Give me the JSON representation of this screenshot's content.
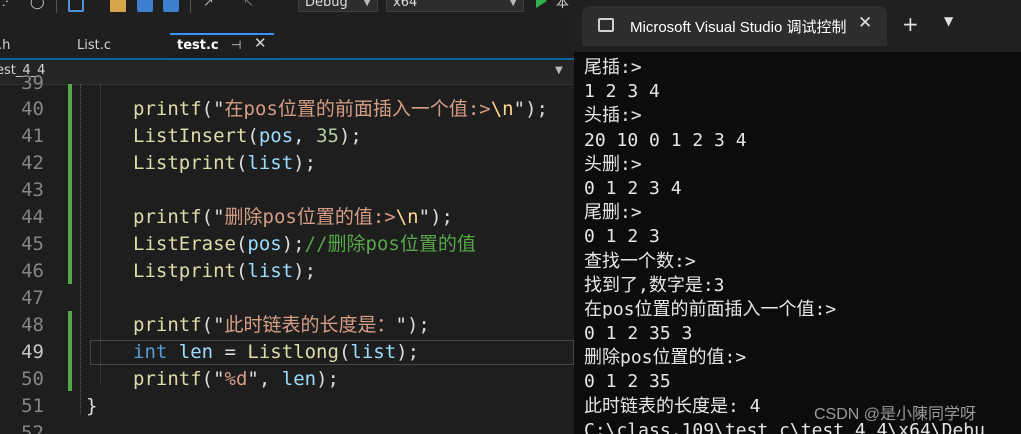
{
  "toolbar": {
    "config": "Debug",
    "platform": "x64",
    "run_label": "本"
  },
  "tabs": [
    {
      "label": ".h"
    },
    {
      "label": "List.c"
    },
    {
      "label": "test.c"
    }
  ],
  "nav": {
    "scope": "est_4_4"
  },
  "code": {
    "line_numbers": [
      "39",
      "40",
      "41",
      "42",
      "43",
      "44",
      "45",
      "46",
      "47",
      "48",
      "49",
      "50",
      "51",
      "52"
    ],
    "l40": {
      "fn": "printf",
      "lp": "(\"",
      "str": "在pos位置的前面插入一个值:>",
      "esc": "\\n",
      "rp": "\");"
    },
    "l41": {
      "fn": "ListInsert",
      "lp": "(",
      "var": "pos",
      "mid": ", ",
      "num": "35",
      "rp": ");"
    },
    "l42": {
      "fn": "Listprint",
      "lp": "(",
      "var": "list",
      "rp": ");"
    },
    "l44": {
      "fn": "printf",
      "lp": "(\"",
      "str": "删除pos位置的值:>",
      "esc": "\\n",
      "rp": "\");"
    },
    "l45": {
      "fn": "ListErase",
      "lp": "(",
      "var": "pos",
      "rp": ");",
      "cm": "//删除pos位置的值"
    },
    "l46": {
      "fn": "Listprint",
      "lp": "(",
      "var": "list",
      "rp": ");"
    },
    "l48": {
      "fn": "printf",
      "lp": "(\"",
      "str": "此时链表的长度是：",
      "rp": "\");"
    },
    "l49": {
      "kw": "int",
      "var1": " len",
      "eq": " = ",
      "fn": "Listlong",
      "lp": "(",
      "var2": "list",
      "rp": ");"
    },
    "l50": {
      "fn": "printf",
      "lp": "(\"",
      "str": "%d",
      "q": "\"",
      "sep": ", ",
      "var": "len",
      "rp": ");"
    },
    "l51": {
      "brace": "}"
    }
  },
  "console": {
    "title": "Microsoft Visual Studio 调试控制台",
    "new_tab": "+",
    "lines": [
      "尾插:>",
      "1 2 3 4",
      "头插:>",
      "20 10 0 1 2 3 4",
      "头删:>",
      "0 1 2 3 4",
      "尾删:>",
      "0 1 2 3",
      "查找一个数:>",
      "找到了,数字是:3",
      "在pos位置的前面插入一个值:>",
      "0 1 2 35 3",
      "删除pos位置的值:>",
      "0 1 2 35",
      "此时链表的长度是: 4",
      "C:\\class.109\\test_c\\test_4_4\\x64\\Debu"
    ]
  },
  "watermark": "CSDN @是小陳同学呀"
}
